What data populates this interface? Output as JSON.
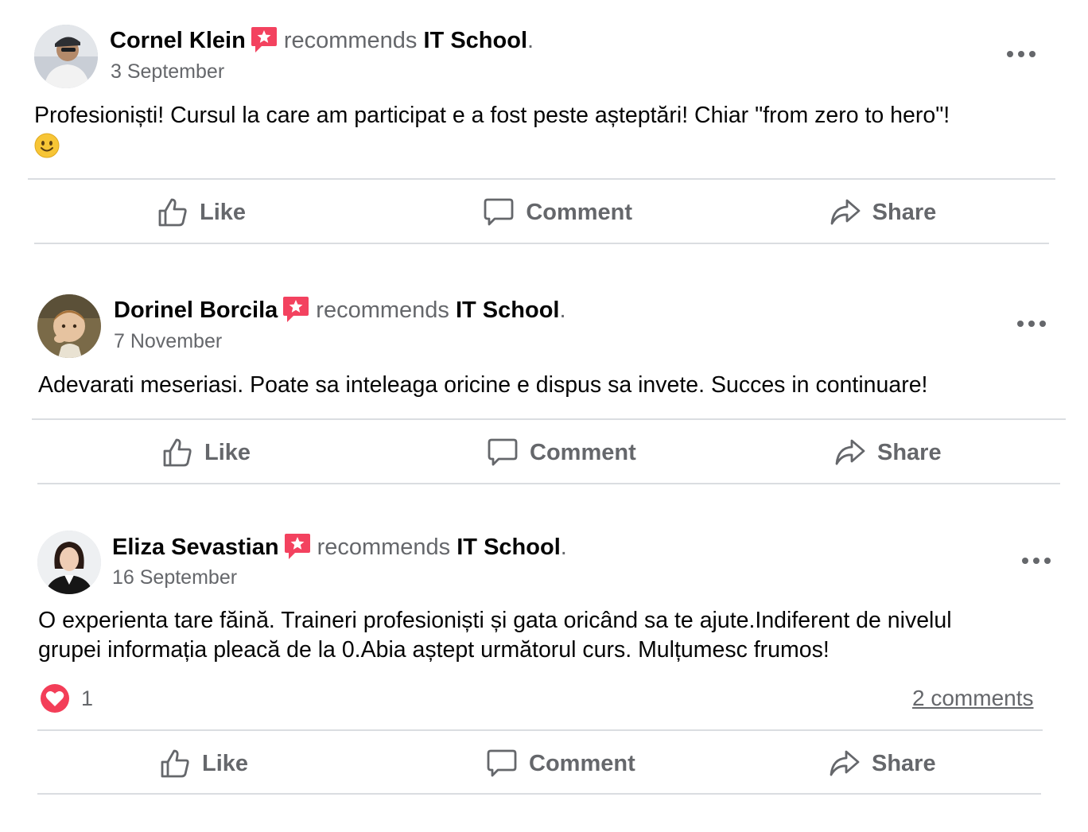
{
  "recommend_text": "recommends",
  "page_name": "IT School",
  "period": ".",
  "actions": {
    "like": "Like",
    "comment": "Comment",
    "share": "Share"
  },
  "icons": {
    "recommend_badge": "recommend-star-icon",
    "more": "more-options-icon",
    "like": "thumbs-up-icon",
    "comment": "comment-bubble-icon",
    "share": "share-arrow-icon",
    "heart": "heart-reaction-icon",
    "emoji": "smiley-emoji-icon"
  },
  "colors": {
    "badge": "#f3425f",
    "heart": "#f33e58",
    "muted": "#65676b",
    "divider": "#dadde1"
  },
  "posts": [
    {
      "author": "Cornel Klein",
      "date": "3 September",
      "text_line_1": "Profesioniști! Cursul la care am participat e a fost peste așteptări! Chiar \"from zero to hero\"!",
      "text_line_2": "",
      "has_emoji": true
    },
    {
      "author": "Dorinel Borcila",
      "date": "7 November",
      "text_line_1": "Adevarati meseriasi. Poate sa inteleaga oricine e dispus sa invete. Succes in continuare!",
      "text_line_2": ""
    },
    {
      "author": "Eliza Sevastian",
      "date": "16 September",
      "text_line_1": "O experienta tare făină. Traineri profesioniști și gata oricând sa te ajute.Indiferent de nivelul",
      "text_line_2": "grupei informația pleacă de la 0.Abia aștept următorul curs. Mulțumesc frumos!",
      "reaction_count": "1",
      "comments_link": "2 comments"
    }
  ]
}
